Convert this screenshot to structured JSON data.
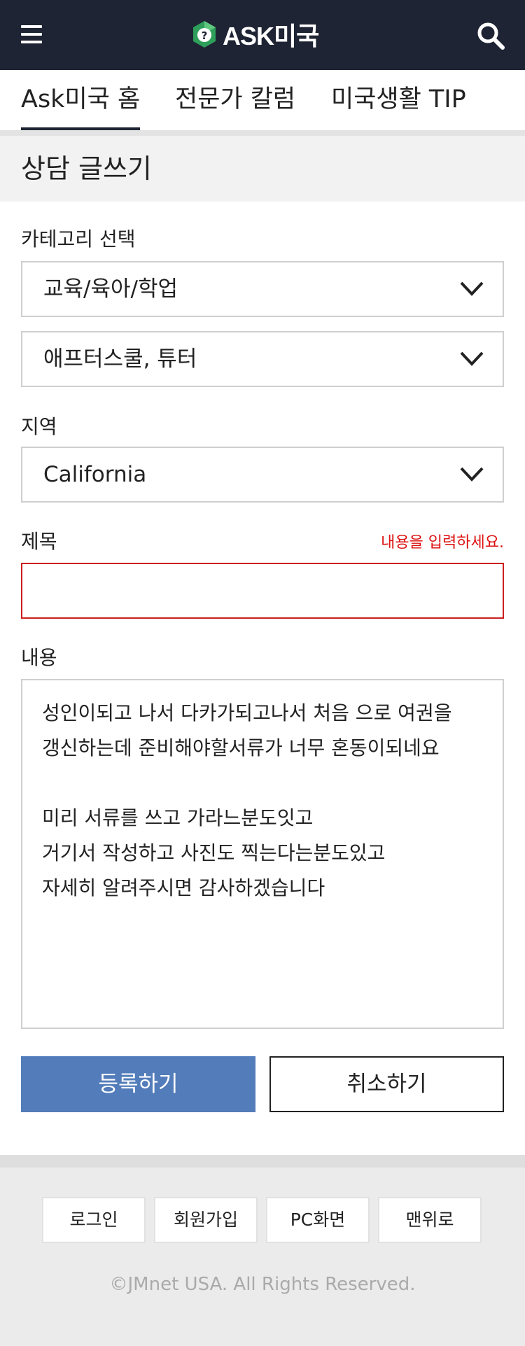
{
  "header": {
    "logo_text": "ASK미국",
    "logo_mark_char": "?",
    "accent_color": "#1e2433",
    "menu_icon": "hamburger-menu-icon",
    "search_icon": "search-icon"
  },
  "tabs": [
    {
      "label": "Ask미국 홈",
      "active": true
    },
    {
      "label": "전문가 칼럼",
      "active": false
    },
    {
      "label": "미국생활 TIP",
      "active": false
    }
  ],
  "page_title": "상담 글쓰기",
  "category": {
    "label": "카테고리 선택",
    "primary": "교육/육아/학업",
    "secondary": "애프터스쿨, 튜터"
  },
  "region": {
    "label": "지역",
    "value": "California"
  },
  "title_field": {
    "label": "제목",
    "error": "내용을 입력하세요.",
    "value": ""
  },
  "content_field": {
    "label": "내용",
    "lines": [
      "성인이되고 나서 다카가되고나서 처음 으로 여권을",
      "갱신하는데 준비해야할서류가 너무 혼동이되네요",
      "",
      "미리 서류를 쓰고 가라느분도잇고",
      "거기서 작성하고 사진도 찍는다는분도있고",
      "자세히 알려주시면 감사하겠습니다"
    ]
  },
  "buttons": {
    "submit": "등록하기",
    "cancel": "취소하기",
    "submit_color": "#527cba"
  },
  "footer": {
    "links": [
      "로그인",
      "회원가입",
      "PC화면",
      "맨위로"
    ],
    "copyright": "©JMnet USA. All Rights Reserved."
  }
}
